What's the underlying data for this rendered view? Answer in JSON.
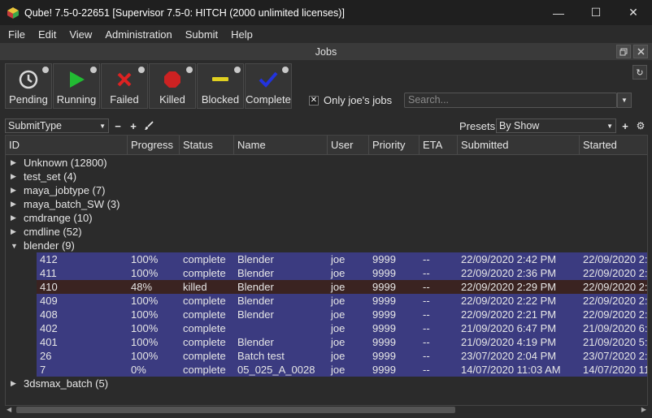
{
  "window": {
    "title": "Qube! 7.5-0-22651 [Supervisor 7.5-0: HITCH (2000 unlimited licenses)]",
    "minimize": "—",
    "maximize": "☐",
    "close": "✕"
  },
  "menu": [
    "File",
    "Edit",
    "View",
    "Administration",
    "Submit",
    "Help"
  ],
  "dock": {
    "title": "Jobs"
  },
  "toolbar": {
    "buttons": [
      {
        "label": "Pending",
        "icon": "clock-icon"
      },
      {
        "label": "Running",
        "icon": "play-icon"
      },
      {
        "label": "Failed",
        "icon": "x-icon"
      },
      {
        "label": "Killed",
        "icon": "stop-icon"
      },
      {
        "label": "Blocked",
        "icon": "minus-icon"
      },
      {
        "label": "Complete",
        "icon": "check-icon"
      }
    ],
    "only_jobs_label": "Only joe's jobs",
    "only_jobs_checked": true,
    "search_placeholder": "Search..."
  },
  "filter": {
    "submit_type": "SubmitType",
    "presets_label": "Presets",
    "presets_value": "By Show"
  },
  "table": {
    "columns": [
      "ID",
      "Progress",
      "Status",
      "Name",
      "User",
      "Priority",
      "ETA",
      "Submitted",
      "Started"
    ],
    "groups": [
      {
        "label": "Unknown (12800)",
        "expanded": false
      },
      {
        "label": "test_set (4)",
        "expanded": false
      },
      {
        "label": "maya_jobtype (7)",
        "expanded": false
      },
      {
        "label": "maya_batch_SW (3)",
        "expanded": false
      },
      {
        "label": "cmdrange (10)",
        "expanded": false
      },
      {
        "label": "cmdline (52)",
        "expanded": false
      },
      {
        "label": "blender (9)",
        "expanded": true
      }
    ],
    "jobs": [
      {
        "id": "412",
        "progress": "100%",
        "status": "complete",
        "name": "Blender",
        "user": "joe",
        "priority": "9999",
        "eta": "--",
        "submitted": "22/09/2020 2:42 PM",
        "started": "22/09/2020 2:4"
      },
      {
        "id": "411",
        "progress": "100%",
        "status": "complete",
        "name": "Blender",
        "user": "joe",
        "priority": "9999",
        "eta": "--",
        "submitted": "22/09/2020 2:36 PM",
        "started": "22/09/2020 2:3"
      },
      {
        "id": "410",
        "progress": "48%",
        "status": "killed",
        "name": "Blender",
        "user": "joe",
        "priority": "9999",
        "eta": "--",
        "submitted": "22/09/2020 2:29 PM",
        "started": "22/09/2020 2:2"
      },
      {
        "id": "409",
        "progress": "100%",
        "status": "complete",
        "name": "Blender",
        "user": "joe",
        "priority": "9999",
        "eta": "--",
        "submitted": "22/09/2020 2:22 PM",
        "started": "22/09/2020 2:2"
      },
      {
        "id": "408",
        "progress": "100%",
        "status": "complete",
        "name": "Blender",
        "user": "joe",
        "priority": "9999",
        "eta": "--",
        "submitted": "22/09/2020 2:21 PM",
        "started": "22/09/2020 2:2"
      },
      {
        "id": "402",
        "progress": "100%",
        "status": "complete",
        "name": "",
        "user": "joe",
        "priority": "9999",
        "eta": "--",
        "submitted": "21/09/2020 6:47 PM",
        "started": "21/09/2020 6:4"
      },
      {
        "id": "401",
        "progress": "100%",
        "status": "complete",
        "name": "Blender",
        "user": "joe",
        "priority": "9999",
        "eta": "--",
        "submitted": "21/09/2020 4:19 PM",
        "started": "21/09/2020 5:4"
      },
      {
        "id": "26",
        "progress": "100%",
        "status": "complete",
        "name": "Batch test",
        "user": "joe",
        "priority": "9999",
        "eta": "--",
        "submitted": "23/07/2020 2:04 PM",
        "started": "23/07/2020 2:0"
      },
      {
        "id": "7",
        "progress": "0%",
        "status": "complete",
        "name": "05_025_A_0028",
        "user": "joe",
        "priority": "9999",
        "eta": "--",
        "submitted": "14/07/2020 11:03 AM",
        "started": "14/07/2020 11"
      }
    ],
    "trailing_group": {
      "label": "3dsmax_batch (5)",
      "expanded": false
    }
  },
  "colors": {
    "complete_row": "#3b3b80",
    "killed_row": "#3a2321"
  }
}
